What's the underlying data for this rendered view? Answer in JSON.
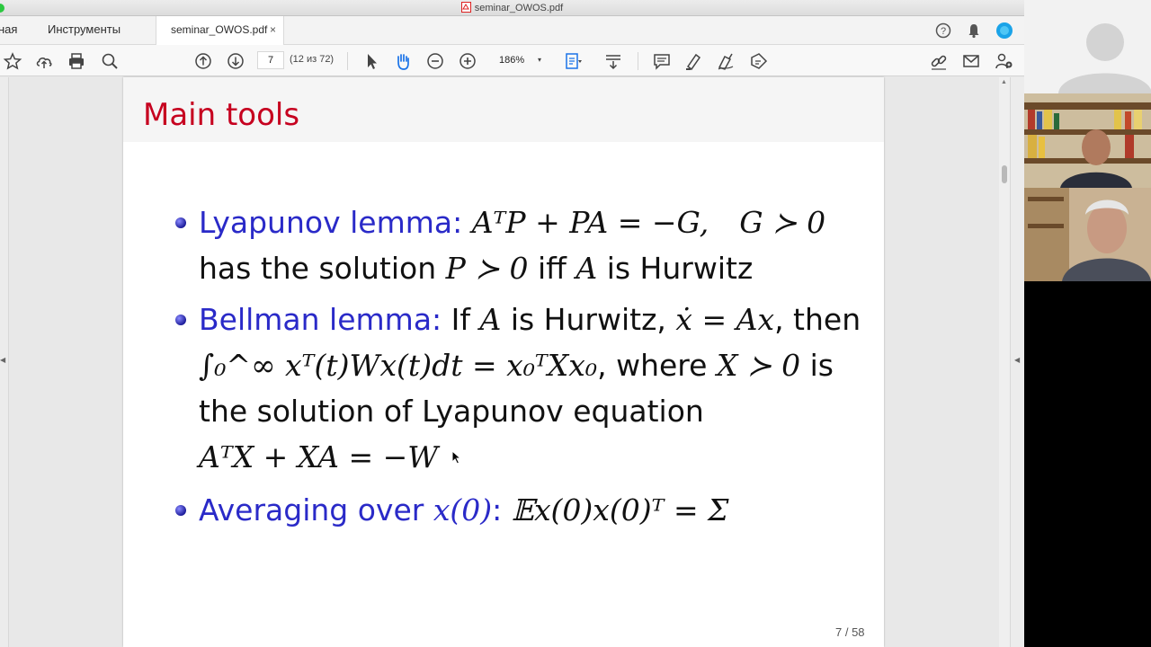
{
  "window": {
    "title": "seminar_OWOS.pdf"
  },
  "tabs": {
    "home_label": "ная",
    "tools_label": "Инструменты",
    "doc_label": "seminar_OWOS.pdf",
    "close_glyph": "×"
  },
  "toolbar": {
    "page_value": "7",
    "page_count": "(12 из 72)",
    "zoom_value": "186%",
    "zoom_caret": "▾"
  },
  "slide": {
    "title": "Main tools",
    "items": [
      {
        "label": "Lyapunov lemma:",
        "eq1": "AᵀP + PA = −G,",
        "eq1b": "G ≻ 0",
        "line2_text1": "has the solution ",
        "line2_math1": "P ≻ 0",
        "line2_text2": " iff ",
        "line2_math2": "A",
        "line2_text3": " is Hurwitz"
      },
      {
        "label": "Bellman lemma:",
        "line1_text1": " If ",
        "line1_math1": "A",
        "line1_text2": " is Hurwitz, ",
        "line1_math2": "ẋ = Ax",
        "line1_text3": ", then",
        "line2_math1": "∫₀^∞ xᵀ(t)Wx(t)dt = x₀ᵀXx₀",
        "line2_text1": ", where ",
        "line2_math2": "X ≻ 0",
        "line2_text2": " is",
        "line3_text": "the solution of Lyapunov equation",
        "line4_math": "AᵀX + XA = −W"
      },
      {
        "label_part1": "Averaging over ",
        "label_math": "x(0)",
        "label_part2": ":",
        "eq": "𝔼x(0)x(0)ᵀ = Σ"
      }
    ],
    "page_number": "7 / 58"
  },
  "colors": {
    "title_red": "#c6001f",
    "beamer_blue": "#2a2ac8",
    "toolbar_blue": "#1a73e8"
  }
}
